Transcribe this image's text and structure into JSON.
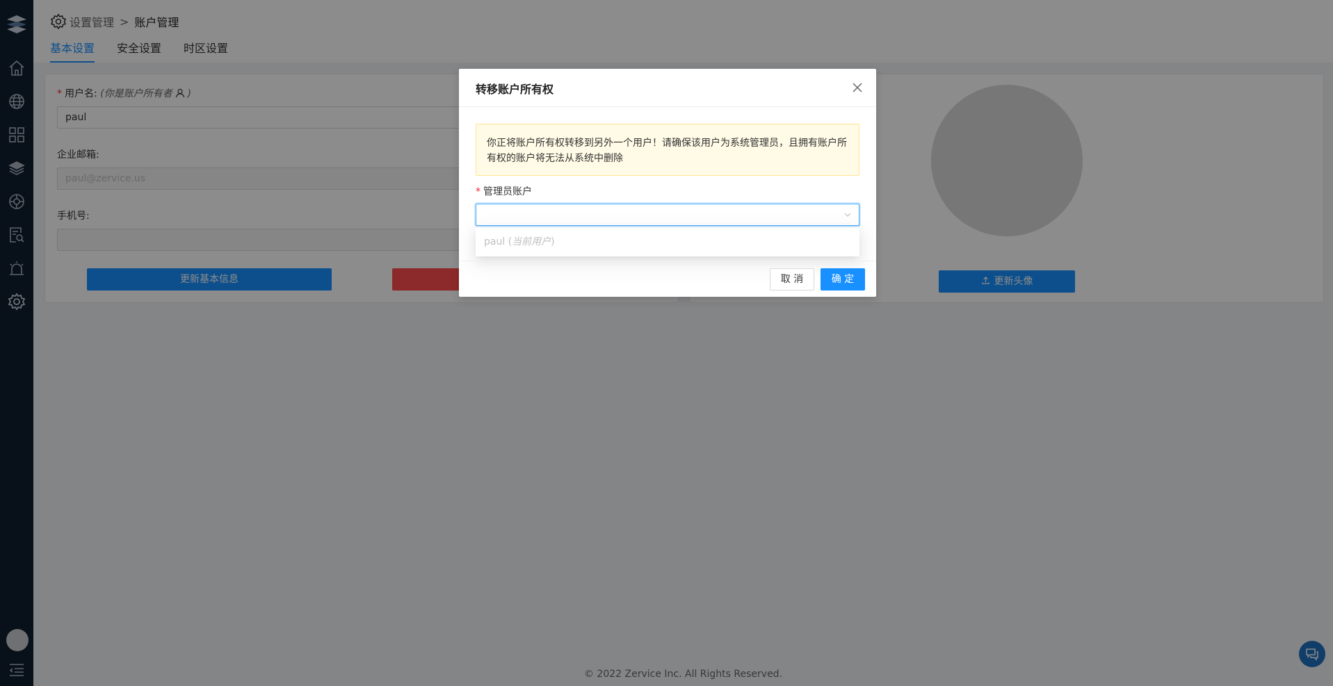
{
  "breadcrumb": {
    "parent": "设置管理",
    "separator": ">",
    "current": "账户管理"
  },
  "tabs": [
    {
      "label": "基本设置",
      "active": true
    },
    {
      "label": "安全设置",
      "active": false
    },
    {
      "label": "时区设置",
      "active": false
    }
  ],
  "sidebar": {
    "items": [
      {
        "icon": "home-icon"
      },
      {
        "icon": "globe-icon"
      },
      {
        "icon": "apps-grid-icon"
      },
      {
        "icon": "layers-icon"
      },
      {
        "icon": "cluster-icon"
      },
      {
        "icon": "search-document-icon"
      },
      {
        "icon": "alarm-icon"
      },
      {
        "icon": "settings-icon"
      }
    ]
  },
  "profile": {
    "username_label": "用户名:",
    "owner_note_open": "(",
    "owner_note": "你是账户所有者",
    "owner_note_close": ")",
    "username_value": "paul",
    "email_label": "企业邮箱:",
    "email_placeholder": "paul@zervice.us",
    "phone_label": "手机号:",
    "update_info_button": "更新基本信息",
    "update_avatar_button": "更新头像"
  },
  "footer": {
    "copyright": "2022 Zervice Inc. All Rights Reserved."
  },
  "modal": {
    "title": "转移账户所有权",
    "alert": "你正将账户所有权转移到另外一个用户！请确保该用户为系统管理员，且拥有账户所有权的账户将无法从系统中删除",
    "admin_label": "管理员账户",
    "select_value": "",
    "options": [
      {
        "name": "paul",
        "note": "当前用户"
      }
    ],
    "cancel": "取 消",
    "confirm": "确 定"
  },
  "colors": {
    "primary": "#1890ff",
    "danger": "#ff4d4f",
    "sidebar": "#0f1e2e",
    "alert_bg": "#fffbe6"
  }
}
